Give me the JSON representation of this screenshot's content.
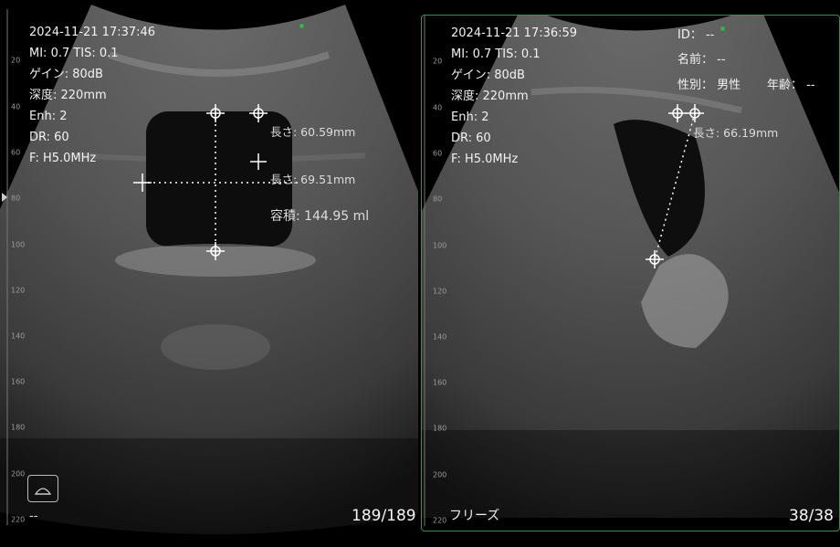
{
  "left": {
    "info": [
      "2024-11-21 17:37:46",
      "MI: 0.7  TIS: 0.1",
      "ゲイン: 80dB",
      "深度: 220mm",
      "Enh: 2",
      "DR: 60",
      "F: H5.0MHz"
    ],
    "meas1": "長さ: 60.59mm",
    "meas2": "長さ: 69.51mm",
    "volume": "容積: 144.95 ml",
    "counter": "189/189",
    "bottom_text": "--",
    "ruler": [
      "20",
      "40",
      "60",
      "80",
      "100",
      "120",
      "140",
      "160",
      "180",
      "200",
      "220"
    ]
  },
  "right": {
    "info": [
      "2024-11-21 17:36:59",
      "MI: 0.7  TIS: 0.1",
      "ゲイン: 80dB",
      "深度: 220mm",
      "Enh: 2",
      "DR: 60",
      "F: H5.0MHz"
    ],
    "id_label": "ID：  --",
    "name_label": "名前：  --",
    "sex_label": "性別：  男性",
    "age_label": "年齢：  --",
    "meas1": "長さ: 66.19mm",
    "counter": "38/38",
    "freeze": "フリーズ",
    "ruler": [
      "20",
      "40",
      "60",
      "80",
      "100",
      "120",
      "140",
      "160",
      "180",
      "200",
      "220"
    ]
  },
  "colors": {
    "accent": "#2fb34a",
    "frame": "#3c8f47"
  }
}
